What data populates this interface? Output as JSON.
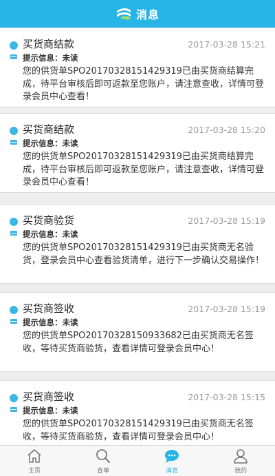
{
  "header": {
    "title": "消息",
    "logo_icon": "app-logo-icon",
    "background": "#27b4e6"
  },
  "messages": [
    {
      "title": "买货商结款",
      "time": "2017-03-28 15:21",
      "hint": "提示信息：未读",
      "body": "您的供货单SPO20170328151429319已由买货商结算完成，待平台审核后即可返款至您账户，请注意查收，详情可登录会员中心查看！"
    },
    {
      "title": "买货商结款",
      "time": "2017-03-28 15:20",
      "hint": "提示信息：未读",
      "body": "您的供货单SPO20170328151429319已由买货商结算完成，待平台审核后即可返款至您账户，请注意查收，详情可登录会员中心查看！"
    },
    {
      "title": "买货商验货",
      "time": "2017-03-28 15:19",
      "hint": "提示信息：未读",
      "body": "您的供货单SPO20170328151429319已由买货商无名验货，登录会员中心查看验货清单，进行下一步确认交易操作！"
    },
    {
      "title": "买货商签收",
      "time": "2017-03-28 15:19",
      "hint": "提示信息：未读",
      "body": "您的供货单SPO20170328150933682已由买货商无名签收，等待买货商验货，查看详情可登录会员中心！"
    },
    {
      "title": "买货商签收",
      "time": "2017-03-28 15:15",
      "hint": "提示信息：未读",
      "body": "您的供货单SPO20170328151429319已由买货商无名签收，等待买货商验货，查看详情可登录会员中心！"
    }
  ],
  "tabs": [
    {
      "label": "主页",
      "icon": "home-icon"
    },
    {
      "label": "查单",
      "icon": "search-icon"
    },
    {
      "label": "消息",
      "icon": "chat-icon",
      "active": true
    },
    {
      "label": "我的",
      "icon": "user-icon"
    }
  ],
  "colors": {
    "accent": "#27b4e6",
    "unread_dot": "#39b8e6"
  }
}
